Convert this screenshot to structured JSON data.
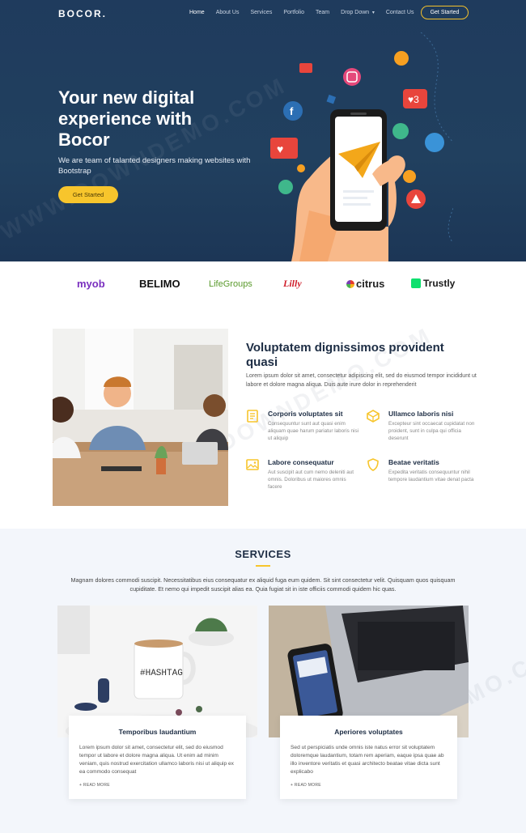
{
  "brand": {
    "logo": "BOCOR."
  },
  "nav": {
    "items": [
      "Home",
      "About Us",
      "Services",
      "Portfolio",
      "Team",
      "Drop Down",
      "Contact Us"
    ],
    "cta": "Get Started"
  },
  "hero": {
    "title": "Your new digital experience with Bocor",
    "subtitle": "We are team of talanted designers making websites with Bootstrap",
    "button": "Get Started"
  },
  "clients": [
    "myob",
    "BELIMO",
    "LifeGroups",
    "Lilly",
    "citrus",
    "Trustly"
  ],
  "about": {
    "title": "Voluptatem dignissimos provident quasi",
    "description": "Lorem ipsum dolor sit amet, consectetur adipiscing elit, sed do eiusmod tempor incididunt ut labore et dolore magna aliqua. Duis aute irure dolor in reprehenderit",
    "features": [
      {
        "icon": "receipt-icon",
        "title": "Corporis voluptates sit",
        "text": "Consequuntur sunt aut quasi enim aliquam quae harum pariatur laboris nisi ut aliquip"
      },
      {
        "icon": "cube-icon",
        "title": "Ullamco laboris nisi",
        "text": "Excepteur sint occaecat cupidatat non proident, sunt in culpa qui officia deserunt"
      },
      {
        "icon": "image-icon",
        "title": "Labore consequatur",
        "text": "Aut suscipit aut cum nemo deleniti aut omnis. Doloribus ut maiores omnis facere"
      },
      {
        "icon": "shield-icon",
        "title": "Beatae veritatis",
        "text": "Expedita veritatis consequuntur nihil tempore laudantium vitae denat pacta"
      }
    ]
  },
  "services": {
    "title": "SERVICES",
    "description": "Magnam dolores commodi suscipit. Necessitatibus eius consequatur ex aliquid fuga eum quidem. Sit sint consectetur velit. Quisquam quos quisquam cupiditate. Et nemo qui impedit suscipit alias ea. Quia fugiat sit in iste officiis commodi quidem hic quas.",
    "cards": [
      {
        "title": "Temporibus laudantium",
        "text": "Lorem ipsum dolor sit amet, consectetur elit, sed do eiusmod tempor ut labore et dolore magna aliqua. Ut enim ad minim veniam, quis nostrud exercitation ullamco laboris nisi ut aliquip ex ea commodo consequat",
        "link": "+ READ MORE"
      },
      {
        "title": "Aperiores voluptates",
        "text": "Sed ut perspiciatis unde omnis iste natus error sit voluptatem doloremque laudantium, totam rem aperiam, eaque ipsa quae ab illo inventore veritatis et quasi architecto beatae vitae dicta sunt explicabo",
        "link": "+ READ MORE"
      }
    ]
  },
  "colors": {
    "hero_bg": "#1f3b5d",
    "accent": "#f7c52c",
    "heading": "#1d2d44"
  }
}
